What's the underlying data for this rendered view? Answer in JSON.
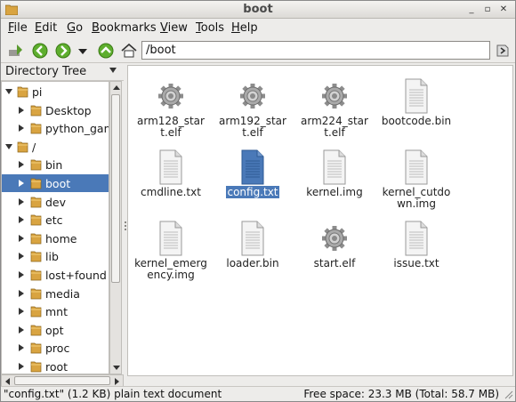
{
  "window": {
    "title": "boot"
  },
  "menu": [
    {
      "label": "File",
      "accel": "F",
      "rest": "ile"
    },
    {
      "label": "Edit",
      "accel": "E",
      "rest": "dit"
    },
    {
      "label": "Go",
      "accel": "G",
      "rest": "o"
    },
    {
      "label": "Bookmarks",
      "accel": "B",
      "rest": "ookmarks"
    },
    {
      "label": "View",
      "accel": "V",
      "rest": "iew"
    },
    {
      "label": "Tools",
      "accel": "T",
      "rest": "ools"
    },
    {
      "label": "Help",
      "accel": "H",
      "rest": "elp"
    }
  ],
  "toolbar": {
    "path": "/boot"
  },
  "sidepane": {
    "header": "Directory Tree"
  },
  "tree": [
    {
      "label": "pi",
      "depth": 0,
      "expanded": true
    },
    {
      "label": "Desktop",
      "depth": 1,
      "expanded": false
    },
    {
      "label": "python_gam",
      "depth": 1,
      "expanded": false
    },
    {
      "label": "/",
      "depth": 0,
      "expanded": true
    },
    {
      "label": "bin",
      "depth": 1,
      "expanded": false
    },
    {
      "label": "boot",
      "depth": 1,
      "expanded": false,
      "selected": true
    },
    {
      "label": "dev",
      "depth": 1,
      "expanded": false
    },
    {
      "label": "etc",
      "depth": 1,
      "expanded": false
    },
    {
      "label": "home",
      "depth": 1,
      "expanded": false
    },
    {
      "label": "lib",
      "depth": 1,
      "expanded": false
    },
    {
      "label": "lost+found",
      "depth": 1,
      "expanded": false
    },
    {
      "label": "media",
      "depth": 1,
      "expanded": false
    },
    {
      "label": "mnt",
      "depth": 1,
      "expanded": false
    },
    {
      "label": "opt",
      "depth": 1,
      "expanded": false
    },
    {
      "label": "proc",
      "depth": 1,
      "expanded": false
    },
    {
      "label": "root",
      "depth": 1,
      "expanded": false
    }
  ],
  "files": [
    {
      "name_lines": [
        "arm128_star",
        "t.elf"
      ],
      "icon": "gear-icon"
    },
    {
      "name_lines": [
        "arm192_star",
        "t.elf"
      ],
      "icon": "gear-icon"
    },
    {
      "name_lines": [
        "arm224_star",
        "t.elf"
      ],
      "icon": "gear-icon"
    },
    {
      "name_lines": [
        "bootcode.bin"
      ],
      "icon": "document-icon"
    },
    {
      "name_lines": [
        "cmdline.txt"
      ],
      "icon": "document-icon"
    },
    {
      "name_lines": [
        "config.txt"
      ],
      "icon": "document-icon",
      "selected": true
    },
    {
      "name_lines": [
        "kernel.img"
      ],
      "icon": "document-icon"
    },
    {
      "name_lines": [
        "kernel_cutdo",
        "wn.img"
      ],
      "icon": "document-icon"
    },
    {
      "name_lines": [
        "kernel_emerg",
        "ency.img"
      ],
      "icon": "document-icon"
    },
    {
      "name_lines": [
        "loader.bin"
      ],
      "icon": "document-icon"
    },
    {
      "name_lines": [
        "start.elf"
      ],
      "icon": "gear-icon"
    },
    {
      "name_lines": [
        "issue.txt"
      ],
      "icon": "document-icon"
    }
  ],
  "status": {
    "selection": "\"config.txt\" (1.2 KB) plain text document",
    "free": "Free space: 23.3 MB (Total: 58.7 MB)"
  },
  "colors": {
    "selection": "#4a79b8",
    "folder": "#d9a441"
  }
}
